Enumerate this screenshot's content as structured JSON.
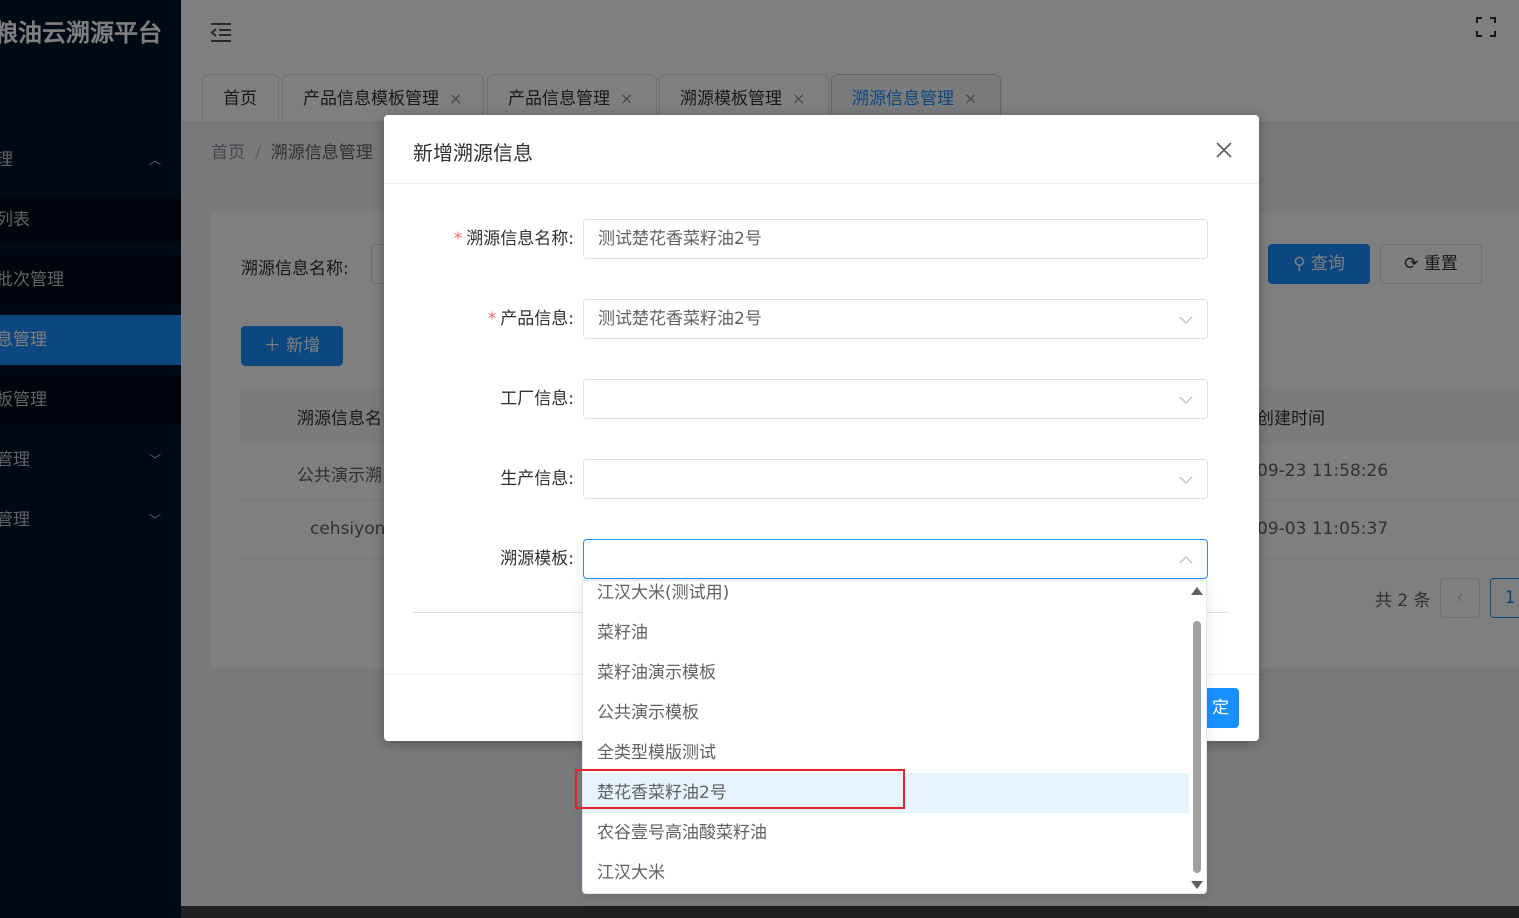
{
  "app": {
    "title": "粮油云溯源平台"
  },
  "sidebar": {
    "items": [
      {
        "label": "理",
        "arrow": "up"
      },
      {
        "label": "列表"
      },
      {
        "label": "批次管理"
      },
      {
        "label": "息管理",
        "active": true
      },
      {
        "label": "板管理"
      },
      {
        "label": "管理",
        "arrow": "down"
      },
      {
        "label": "管理",
        "arrow": "down"
      }
    ]
  },
  "tabs": [
    {
      "label": "首页",
      "closable": false
    },
    {
      "label": "产品信息模板管理",
      "closable": true
    },
    {
      "label": "产品信息管理",
      "closable": true
    },
    {
      "label": "溯源模板管理",
      "closable": true
    },
    {
      "label": "溯源信息管理",
      "closable": true,
      "active": true
    }
  ],
  "tab_close_glyph": "×",
  "breadcrumb": {
    "home": "首页",
    "sep": "/",
    "current": "溯源信息管理"
  },
  "search": {
    "label": "溯源信息名称:",
    "query_label": "查询",
    "reset_label": "重置"
  },
  "toolbar": {
    "add_label": "新增"
  },
  "table": {
    "header_name": "溯源信息名",
    "header_time": "创建时间",
    "rows": [
      {
        "name": "公共演示溯",
        "time": "09-23 11:58:26"
      },
      {
        "name": "cehsiyong",
        "time": "09-03 11:05:37"
      }
    ]
  },
  "pagination": {
    "total": "共 2 条",
    "page": "1"
  },
  "dialog": {
    "title": "新增溯源信息",
    "fields": [
      {
        "label": "溯源信息名称:",
        "required": true,
        "value": "测试楚花香菜籽油2号"
      },
      {
        "label": "产品信息:",
        "required": true,
        "value": "测试楚花香菜籽油2号"
      },
      {
        "label": "工厂信息:",
        "required": false,
        "value": ""
      },
      {
        "label": "生产信息:",
        "required": false,
        "value": ""
      },
      {
        "label": "溯源模板:",
        "required": false,
        "value": ""
      }
    ],
    "confirm_label": "定"
  },
  "dropdown": {
    "options": [
      "江汉大米(测试用)",
      "菜籽油",
      "菜籽油演示模板",
      "公共演示模板",
      "全类型模版测试",
      "楚花香菜籽油2号",
      "农谷壹号高油酸菜籽油",
      "江汉大米"
    ],
    "hovered_index": 5
  },
  "colors": {
    "primary": "#1890ff",
    "sidebar": "#001529",
    "highlight": "#e0262d"
  }
}
